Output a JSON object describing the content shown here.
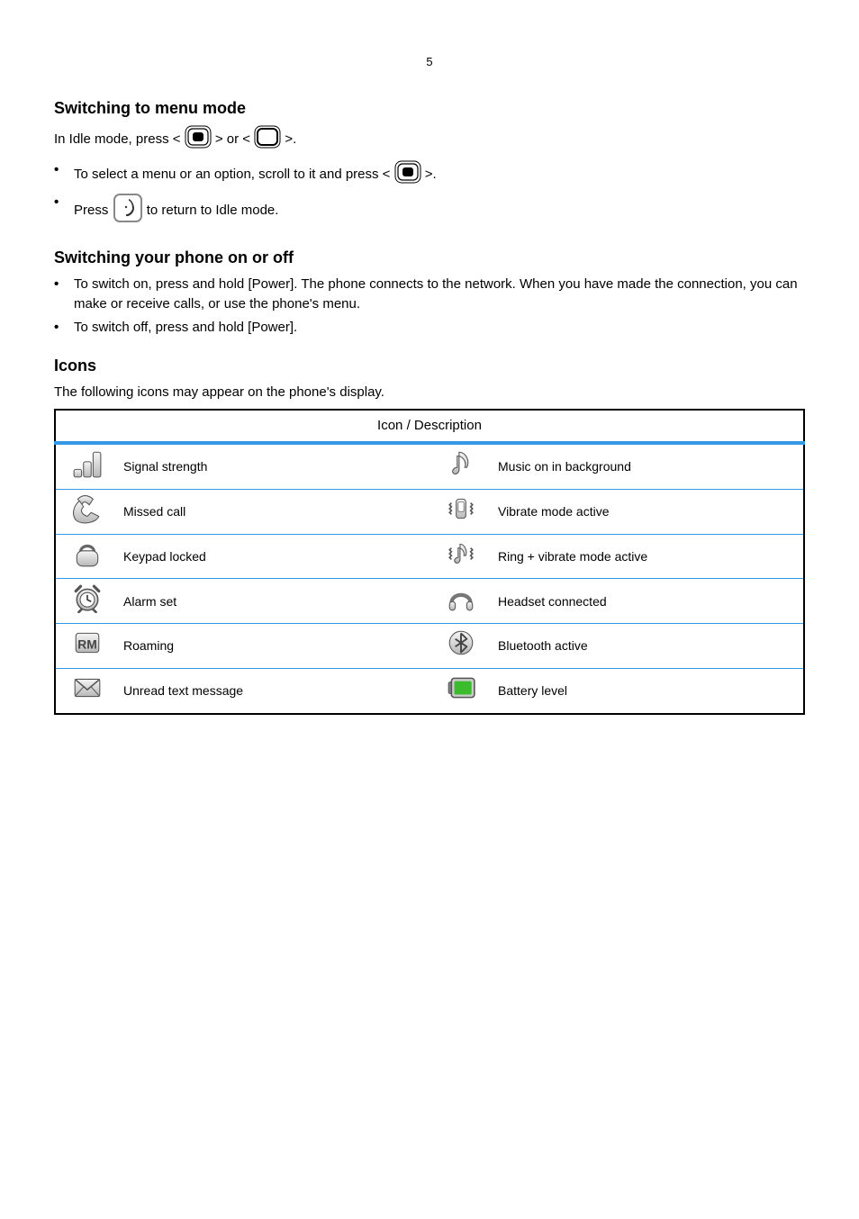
{
  "page_number": "5",
  "h_mode_section": {
    "heading": "Switching to menu mode",
    "p1_before": "In Idle mode, press <",
    "p1_mid": "> or <",
    "p1_after": ">.",
    "bullet1_before": "To select a menu or an option, scroll to it and press <",
    "bullet1_after": ">.",
    "bullet2_before": "Press ",
    "bullet2_after": " to return to Idle mode."
  },
  "h_onoff_section": {
    "heading": "Switching your phone on or off",
    "bullet1": "To switch on, press and hold [Power]. The phone connects to the network. When you have made the connection, you can make or receive calls, or use the phone's menu.",
    "bullet2": "To switch off, press and hold [Power]."
  },
  "h_icons_section": {
    "heading": "Icons",
    "intro": "The following icons may appear on the phone's display.",
    "table_header": "Icon / Description"
  },
  "icons": [
    {
      "name": "signal-strength-icon",
      "label": "Signal strength"
    },
    {
      "name": "missed-call-icon",
      "label": "Missed call"
    },
    {
      "name": "keypad-lock-icon",
      "label": "Keypad locked"
    },
    {
      "name": "alarm-set-icon",
      "label": "Alarm set"
    },
    {
      "name": "roaming-icon",
      "label": "Roaming"
    },
    {
      "name": "unread-text-icon",
      "label": "Unread text message"
    },
    {
      "name": "music-on-icon",
      "label": "Music on in background"
    },
    {
      "name": "vibrate-active-icon",
      "label": "Vibrate mode active"
    },
    {
      "name": "ring-vibrate-icon",
      "label": "Ring + vibrate mode active"
    },
    {
      "name": "headset-connected-icon",
      "label": "Headset connected"
    },
    {
      "name": "bluetooth-active-icon",
      "label": "Bluetooth active"
    },
    {
      "name": "battery-level-icon",
      "label": "Battery level"
    }
  ]
}
